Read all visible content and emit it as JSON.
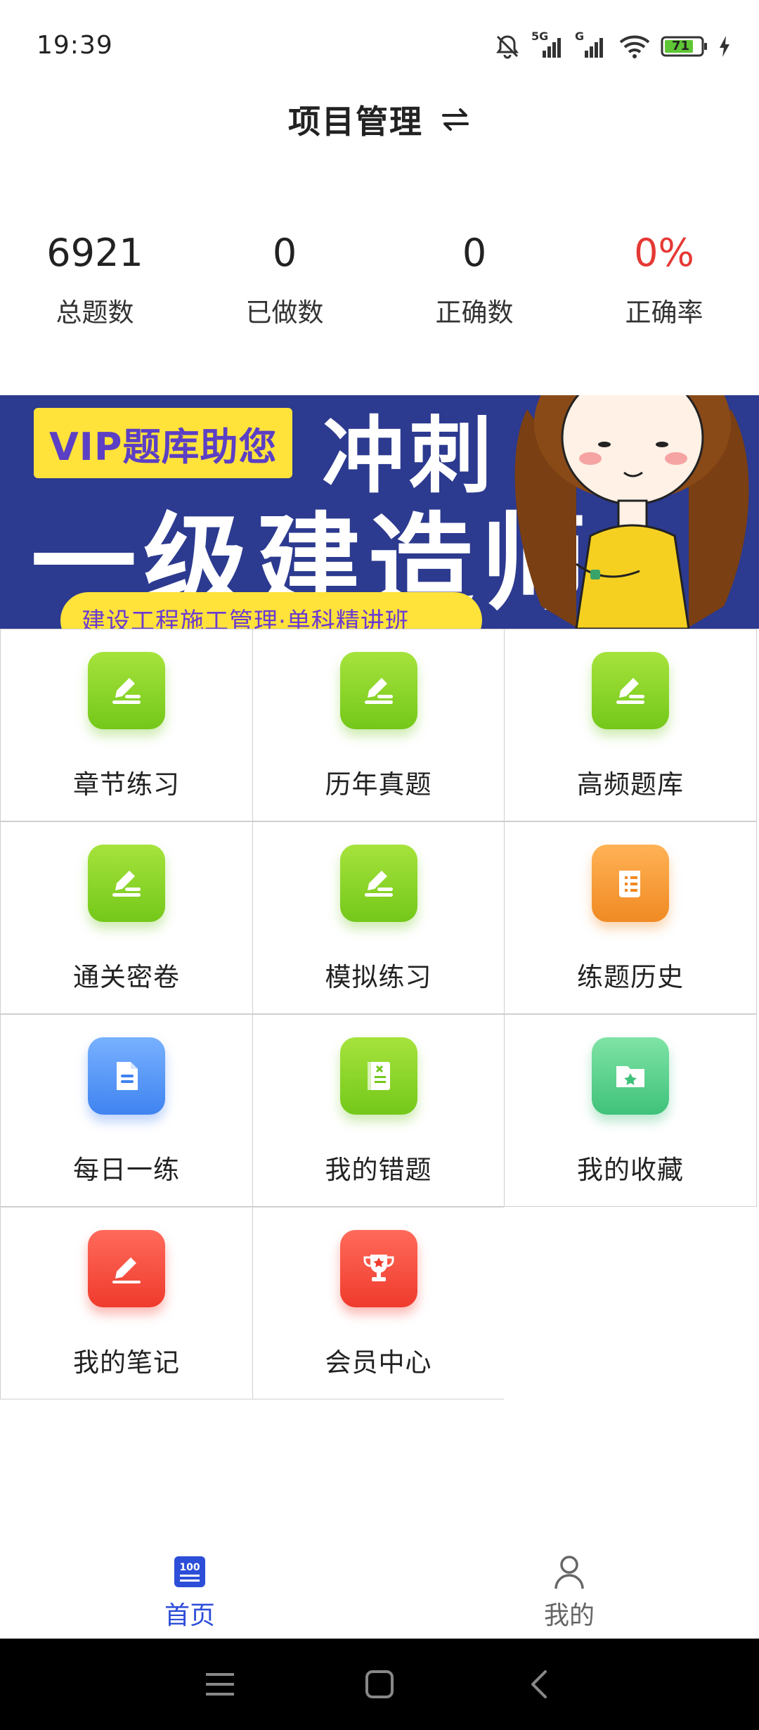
{
  "status_bar": {
    "time": "19:39",
    "network_5g": "5G",
    "network_g": "G",
    "battery": "71",
    "icons": [
      "bell-muted-icon",
      "signal-5g-icon",
      "signal-g-icon",
      "wifi-icon",
      "battery-icon",
      "charging-icon"
    ]
  },
  "header": {
    "title": "项目管理",
    "switch_icon": "swap-arrows-icon"
  },
  "stats": [
    {
      "value": "6921",
      "label": "总题数"
    },
    {
      "value": "0",
      "label": "已做数"
    },
    {
      "value": "0",
      "label": "正确数"
    },
    {
      "value": "0%",
      "label": "正确率"
    }
  ],
  "banner": {
    "pill": "VIP题库助您",
    "sprint": "冲刺",
    "main": "一级建造师",
    "sub": "建设工程施工管理·单科精讲班"
  },
  "grid": {
    "rows": [
      [
        {
          "label": "章节练习",
          "icon": "edit-pen-icon",
          "color": "#8bd62b"
        },
        {
          "label": "历年真题",
          "icon": "edit-pen-icon",
          "color": "#8bd62b"
        },
        {
          "label": "高频题库",
          "icon": "edit-pen-icon",
          "color": "#8bd62b"
        }
      ],
      [
        {
          "label": "通关密卷",
          "icon": "edit-pen-icon",
          "color": "#8bd62b"
        },
        {
          "label": "模拟练习",
          "icon": "edit-pen-icon",
          "color": "#8bd62b"
        },
        {
          "label": "练题历史",
          "icon": "scroll-list-icon",
          "color": "#f59b39"
        }
      ],
      [
        {
          "label": "每日一练",
          "icon": "document-icon",
          "color": "#5b9af5"
        },
        {
          "label": "我的错题",
          "icon": "error-book-icon",
          "color": "#8bd62b"
        },
        {
          "label": "我的收藏",
          "icon": "star-folder-icon",
          "color": "#4fcf8a"
        }
      ],
      [
        {
          "label": "我的笔记",
          "icon": "note-pen-icon",
          "color": "#f24a3a"
        },
        {
          "label": "会员中心",
          "icon": "trophy-icon",
          "color": "#f24a3a"
        }
      ]
    ]
  },
  "tabbar": {
    "tabs": [
      {
        "label": "首页",
        "icon": "home-100-icon",
        "active": true
      },
      {
        "label": "我的",
        "icon": "person-icon",
        "active": false
      }
    ],
    "active_color": "#2d4ed8"
  },
  "system_nav": {
    "icons": [
      "menu-icon",
      "home-square-icon",
      "back-icon"
    ]
  }
}
